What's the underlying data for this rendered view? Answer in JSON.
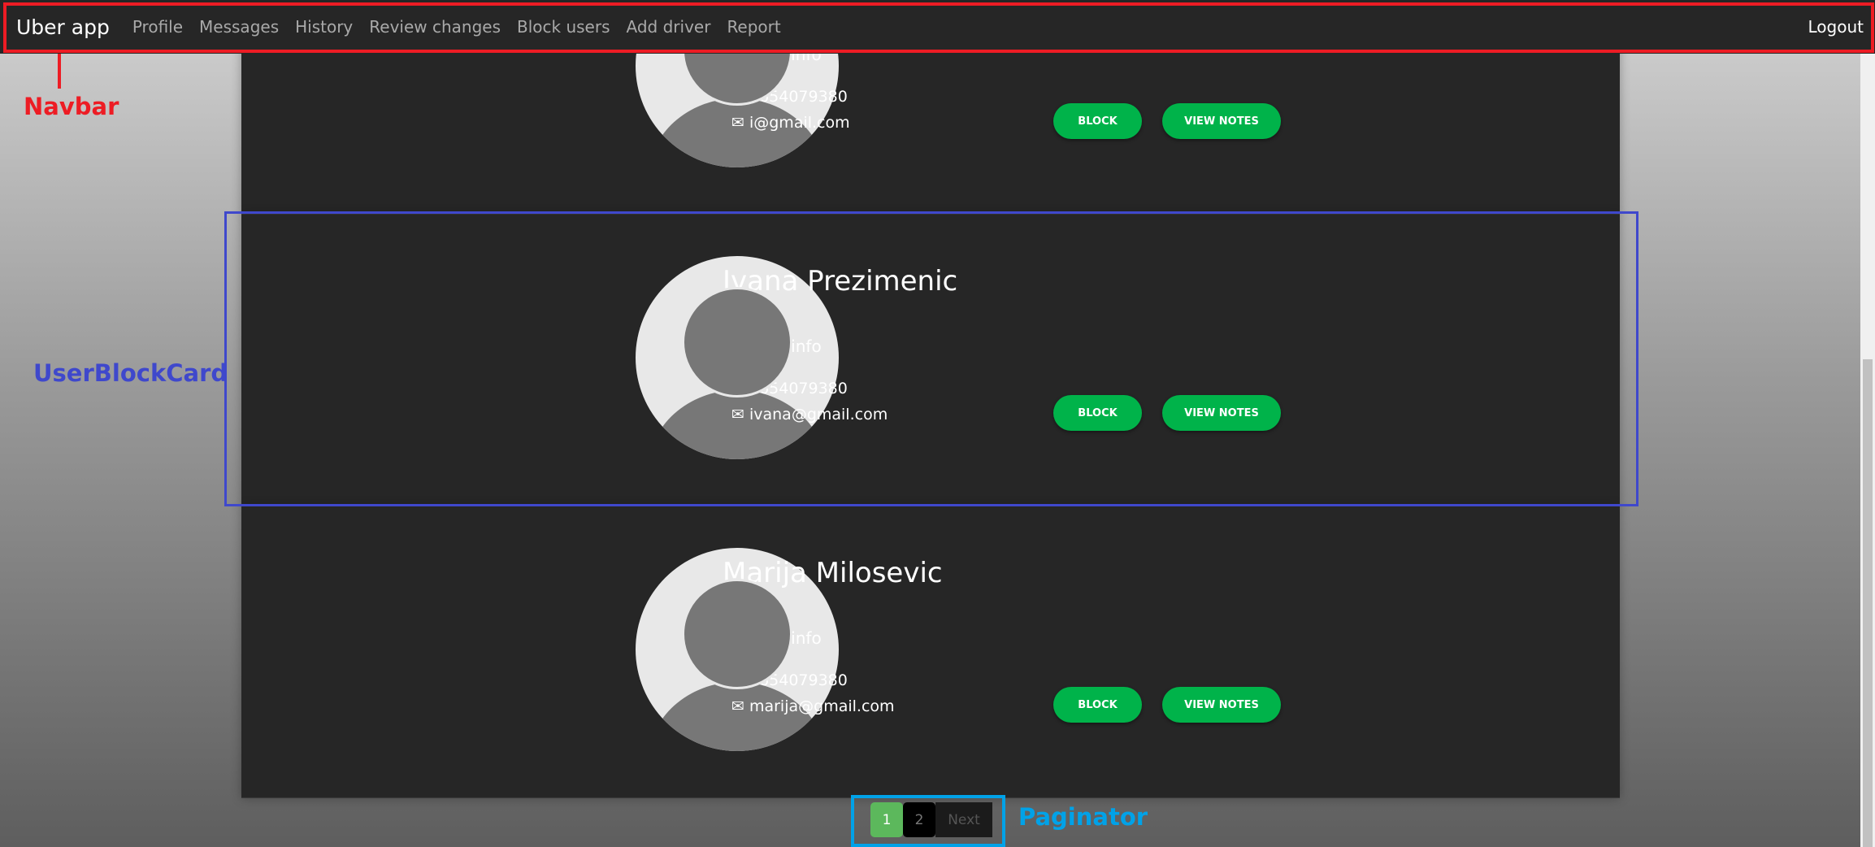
{
  "navbar": {
    "brand": "Uber app",
    "links": [
      "Profile",
      "Messages",
      "History",
      "Review changes",
      "Block users",
      "Add driver",
      "Report"
    ],
    "logout": "Logout"
  },
  "annotations": {
    "navbar": "Navbar",
    "card": "UserBlockCard",
    "paginator": "Paginator"
  },
  "users": [
    {
      "name": "",
      "contact_label": "Contact info",
      "phone": "0654079380",
      "email": "i@gmail.com"
    },
    {
      "name": "Ivana Prezimenic",
      "contact_label": "Contact info",
      "phone": "0654079380",
      "email": "ivana@gmail.com"
    },
    {
      "name": "Marija Milosevic",
      "contact_label": "Contact info",
      "phone": "0654079380",
      "email": "marija@gmail.com"
    }
  ],
  "buttons": {
    "block": "BLOCK",
    "view_notes": "VIEW NOTES"
  },
  "paginator": {
    "pages": [
      "1",
      "2"
    ],
    "current": "1",
    "next": "Next"
  },
  "colors": {
    "accent": "#00b34a",
    "navbar": "#262626",
    "annotation_red": "#ed1c24",
    "annotation_blue": "#3f48cc",
    "annotation_cyan": "#00a2e8"
  }
}
